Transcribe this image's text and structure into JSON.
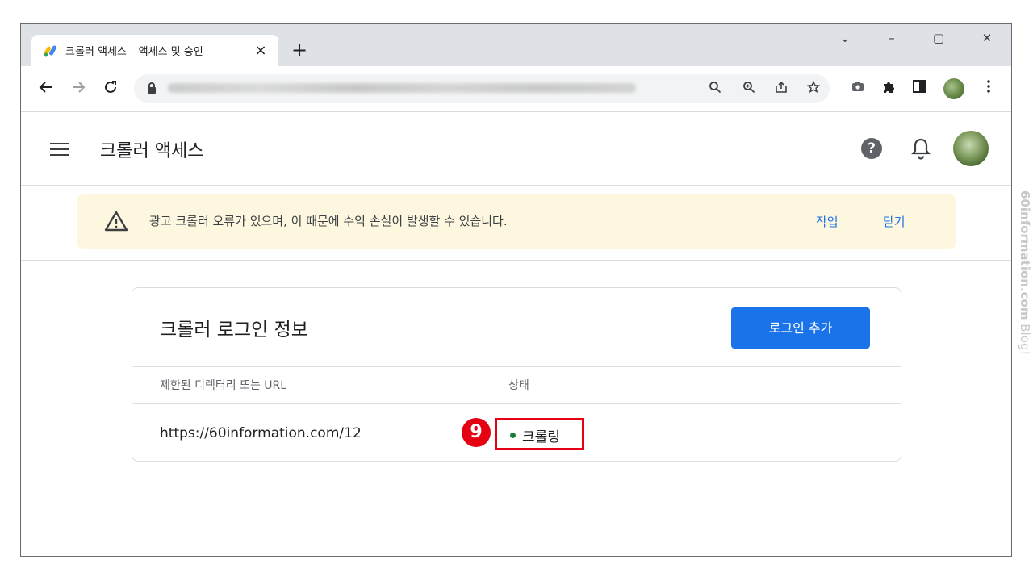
{
  "browser": {
    "tab_title": "크롤러 액세스 – 액세스 및 승인",
    "tab_close": "×",
    "new_tab": "+",
    "window_controls": [
      "⌄",
      "–",
      "▢",
      "✕"
    ]
  },
  "app": {
    "page_title": "크롤러 액세스",
    "help_symbol": "?"
  },
  "banner": {
    "message": "광고 크롤러 오류가 있으며, 이 때문에 수익 손실이 발생할 수 있습니다.",
    "action_label": "작업",
    "dismiss_label": "닫기"
  },
  "card": {
    "title": "크롤러 로그인 정보",
    "add_button": "로그인 추가",
    "columns": [
      "제한된 디렉터리 또는 URL",
      "상태"
    ],
    "rows": [
      {
        "url": "https://60information.com/12",
        "status": "크롤링"
      }
    ]
  },
  "annotation": {
    "step_number": "9",
    "color": "#e50012"
  },
  "watermark": {
    "bold": "60information.com",
    "light": " Blog!"
  },
  "colors": {
    "accent": "#1a73e8",
    "banner_bg": "#fef7e0",
    "status_ok": "#188038"
  },
  "icons": {
    "toolbar": [
      "back-arrow-icon",
      "forward-arrow-icon",
      "reload-icon",
      "lock-icon",
      "search-icon",
      "zoom-icon",
      "share-icon",
      "star-icon",
      "camera-icon",
      "puzzle-icon",
      "side-panel-icon",
      "profile-avatar",
      "more-vert-icon"
    ],
    "header": [
      "menu-icon",
      "help-icon",
      "bell-icon",
      "avatar"
    ]
  }
}
